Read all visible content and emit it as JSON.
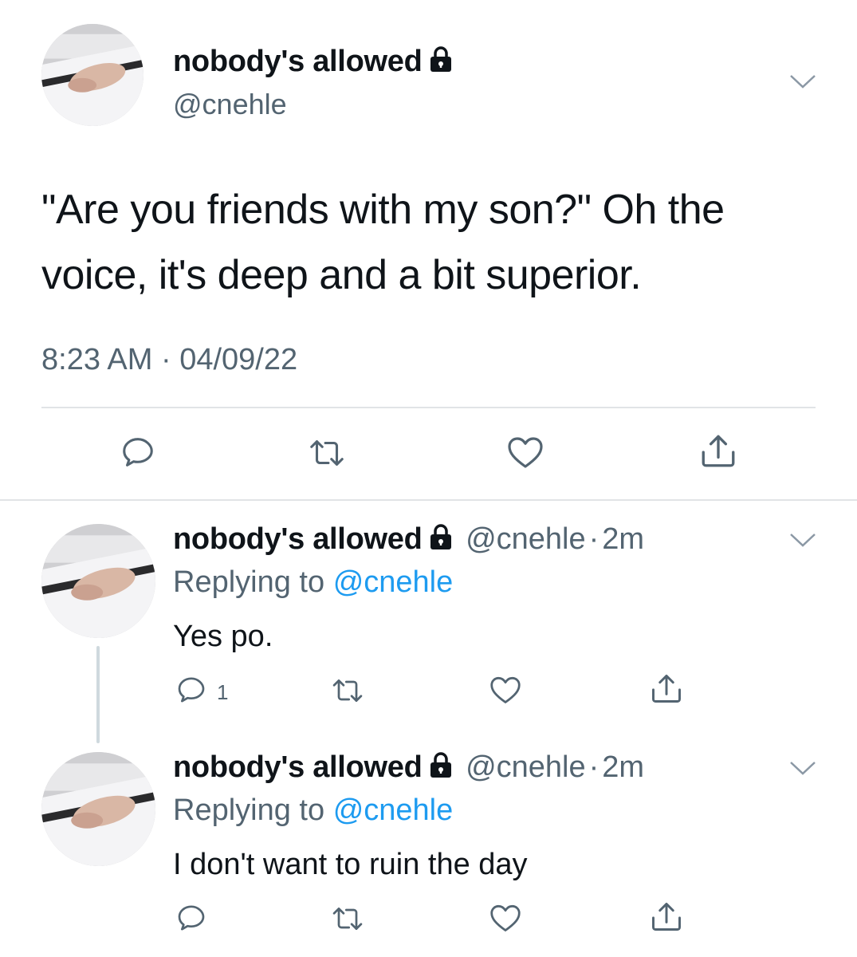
{
  "main_tweet": {
    "display_name": "nobody's allowed",
    "handle": "@cnehle",
    "text_line1": "\"Are you friends with my son?\" Oh the",
    "text_line2": "voice, it's deep and a bit superior.",
    "time": "8:23 AM",
    "separator": "·",
    "date": "04/09/22"
  },
  "replies": [
    {
      "display_name": "nobody's allowed",
      "handle": "@cnehle",
      "separator": "·",
      "time_ago": "2m",
      "replying_prefix": "Replying to",
      "replying_to": "@cnehle",
      "text": "Yes po.",
      "reply_count": "1"
    },
    {
      "display_name": "nobody's allowed",
      "handle": "@cnehle",
      "separator": "·",
      "time_ago": "2m",
      "replying_prefix": "Replying to",
      "replying_to": "@cnehle",
      "text": "I don't want to ruin the day",
      "reply_count": ""
    }
  ],
  "icons": {
    "reply": "reply-icon",
    "retweet": "retweet-icon",
    "like": "heart-icon",
    "share": "share-icon",
    "lock": "lock-icon",
    "more": "chevron-down-icon"
  },
  "colors": {
    "text": "#0f1419",
    "secondary": "#536471",
    "link": "#1d9bf0",
    "divider": "#e1e4e6"
  }
}
